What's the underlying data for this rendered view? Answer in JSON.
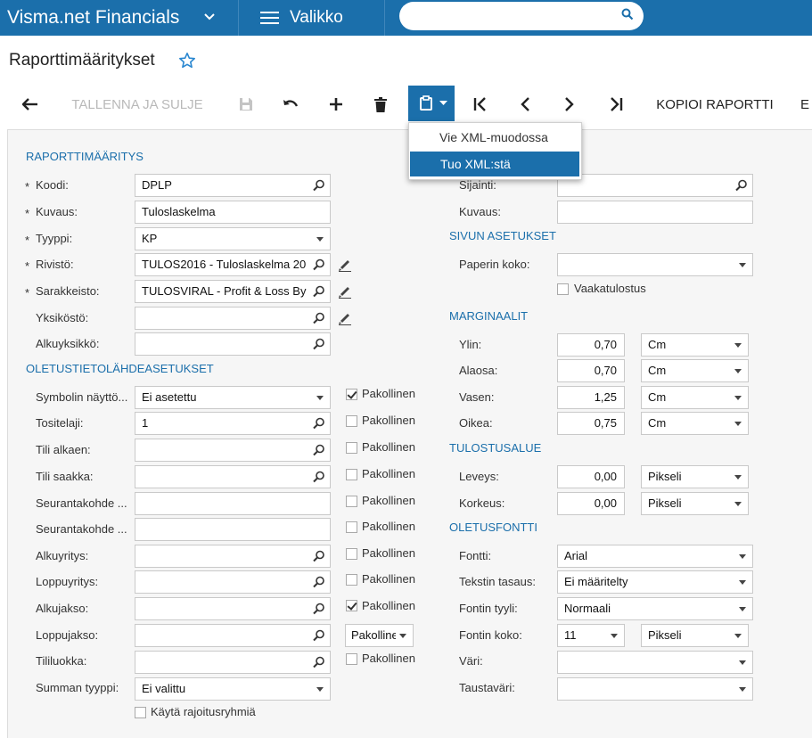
{
  "topbar": {
    "brand": "Visma.net Financials",
    "menu_label": "Valikko",
    "search_placeholder": ""
  },
  "page": {
    "title": "Raporttimääritykset"
  },
  "toolbar": {
    "save_close": "TALLENNA JA SULJE",
    "copy_report": "KOPIOI RAPORTTI",
    "overflow_letter": "E"
  },
  "export_menu": {
    "items": [
      "Vie XML-muodossa",
      "Tuo XML:stä"
    ]
  },
  "form": {
    "report_def": {
      "heading": "RAPORTTIMÄÄRITYS",
      "code_label": "Koodi:",
      "code_value": "DPLP",
      "desc_label": "Kuvaus:",
      "desc_value": "Tuloslaskelma",
      "type_label": "Tyyppi:",
      "type_value": "KP",
      "rows_label": "Rivistö:",
      "rows_value": "TULOS2016 - Tuloslaskelma 20",
      "cols_label": "Sarakkeisto:",
      "cols_value": "TULOSVIRAL - Profit & Loss By",
      "units_label": "Yksiköstö:",
      "units_value": "",
      "startunit_label": "Alkuyksikkö:",
      "startunit_value": ""
    },
    "defaults": {
      "heading": "OLETUSTIETOLÄHDEASETUKSET",
      "rows": [
        {
          "label": "Symbolin näyttö...",
          "value": "Ei asetettu",
          "kind": "dropdown",
          "required_label": "Pakollinen",
          "required": true
        },
        {
          "label": "Tositelaji:",
          "value": "1",
          "kind": "lookup",
          "required_label": "Pakollinen",
          "required": false
        },
        {
          "label": "Tili alkaen:",
          "value": "",
          "kind": "lookup",
          "required_label": "Pakollinen",
          "required": false
        },
        {
          "label": "Tili saakka:",
          "value": "",
          "kind": "lookup",
          "required_label": "Pakollinen",
          "required": false
        },
        {
          "label": "Seurantakohde ...",
          "value": "",
          "kind": "text",
          "required_label": "Pakollinen",
          "required": false
        },
        {
          "label": "Seurantakohde ...",
          "value": "",
          "kind": "text",
          "required_label": "Pakollinen",
          "required": false
        },
        {
          "label": "Alkuyritys:",
          "value": "",
          "kind": "lookup",
          "required_label": "Pakollinen",
          "required": false
        },
        {
          "label": "Loppuyritys:",
          "value": "",
          "kind": "lookup",
          "required_label": "Pakollinen",
          "required": false
        },
        {
          "label": "Alkujakso:",
          "value": "",
          "kind": "lookup",
          "required_label": "Pakollinen",
          "required": true
        },
        {
          "label": "Loppujakso:",
          "value": "",
          "kind": "lookup",
          "required_label": "Pakolline",
          "required": false
        },
        {
          "label": "Tililuokka:",
          "value": "",
          "kind": "lookup",
          "required_label": "Pakollinen",
          "required": false
        },
        {
          "label": "Summan tyyppi:",
          "value": "Ei valittu",
          "kind": "dropdown",
          "required_label": "",
          "required": false
        }
      ],
      "restriction_label": "Käytä rajoitusryhmiä"
    },
    "right": {
      "location_label": "Sijainti:",
      "location_value": "",
      "desc_label": "Kuvaus:",
      "desc_value": "",
      "page_heading": "SIVUN ASETUKSET",
      "paper_label": "Paperin koko:",
      "paper_value": "",
      "landscape_label": "Vaakatulostus",
      "margins_heading": "MARGINAALIT",
      "margins": [
        {
          "label": "Ylin:",
          "value": "0,70",
          "unit": "Cm"
        },
        {
          "label": "Alaosa:",
          "value": "0,70",
          "unit": "Cm"
        },
        {
          "label": "Vasen:",
          "value": "1,25",
          "unit": "Cm"
        },
        {
          "label": "Oikea:",
          "value": "0,75",
          "unit": "Cm"
        }
      ],
      "print_heading": "TULOSTUSALUE",
      "print": [
        {
          "label": "Leveys:",
          "value": "0,00",
          "unit": "Pikseli"
        },
        {
          "label": "Korkeus:",
          "value": "0,00",
          "unit": "Pikseli"
        }
      ],
      "font_heading": "OLETUSFONTTI",
      "font_label": "Fontti:",
      "font_value": "Arial",
      "align_label": "Tekstin tasaus:",
      "align_value": "Ei määritelty",
      "style_label": "Fontin tyyli:",
      "style_value": "Normaali",
      "size_label": "Fontin koko:",
      "size_value": "11",
      "size_unit": "Pikseli",
      "color_label": "Väri:",
      "color_value": "",
      "bg_label": "Taustaväri:",
      "bg_value": ""
    }
  },
  "colors": {
    "brand_blue": "#1b6fab",
    "panel_bg": "#f6f6f6",
    "section_heading": "#1b6fab"
  }
}
